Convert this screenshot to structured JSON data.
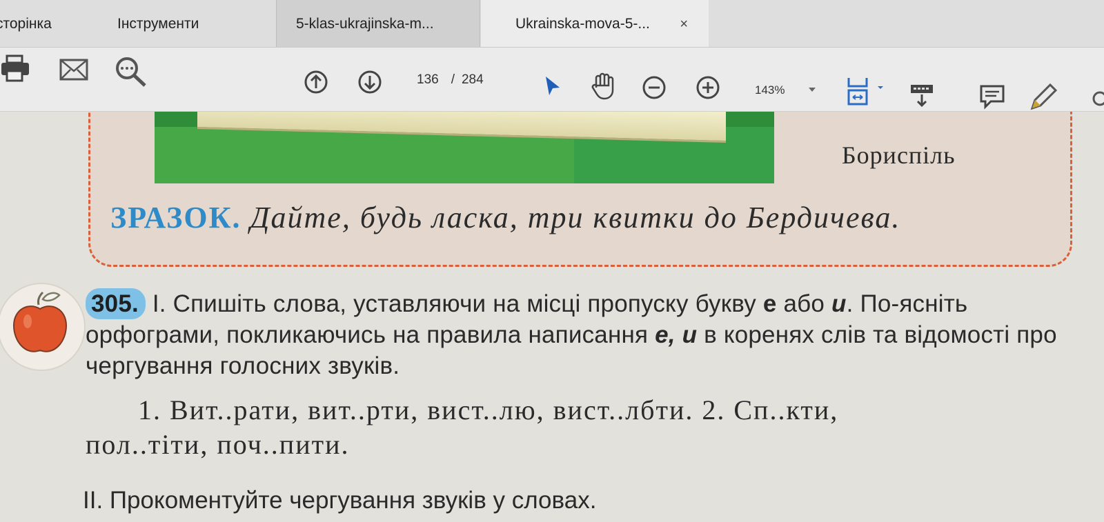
{
  "tabs": {
    "home": "сторінка",
    "tools": "Інструменти",
    "doc1": "5-klas-ukrajinska-m...",
    "doc2": "Ukrainska-mova-5-...",
    "close": "×"
  },
  "toolbar": {
    "current_page": "136",
    "page_separator": "/",
    "total_pages": "284",
    "zoom": "143%"
  },
  "icons": [
    "print-icon",
    "email-icon",
    "search-icon",
    "page-up-icon",
    "page-down-icon",
    "select-cursor-icon",
    "hand-tool-icon",
    "zoom-out-icon",
    "zoom-in-icon",
    "fit-page-icon",
    "scroll-mode-icon",
    "comment-icon",
    "pen-icon",
    "apple-icon"
  ],
  "document": {
    "city": "Бориспіль",
    "sample_label": "ЗРАЗОК.",
    "sample_text": "Дайте, будь ласка, три квитки до Бердичева.",
    "exercise_number": "305.",
    "exercise_p1": " І. Спишіть слова, уставляючи на місці пропуску букву ",
    "letter_e": "е",
    "word_or": " або ",
    "letter_y": "и",
    "exercise_p2": ". По-ясніть орфограми, покликаючись на правила написання ",
    "letters_ey": "е, и",
    "exercise_p3": " в коренях слів та відомості про чергування голосних звуків.",
    "examples_line1": "1. Вит..рати, вит..рти, вист..лю, вист..лбти. 2. Сп..кти,",
    "examples_line2": "пол..тіти, поч..пити.",
    "task2": "ІІ. Прокоментуйте чергування звуків у словах."
  },
  "colors": {
    "sample_label": "#2f8bc8",
    "frame_dash": "#d9603a",
    "number_highlight": "#7fc1e6",
    "apple": "#e0542c"
  }
}
